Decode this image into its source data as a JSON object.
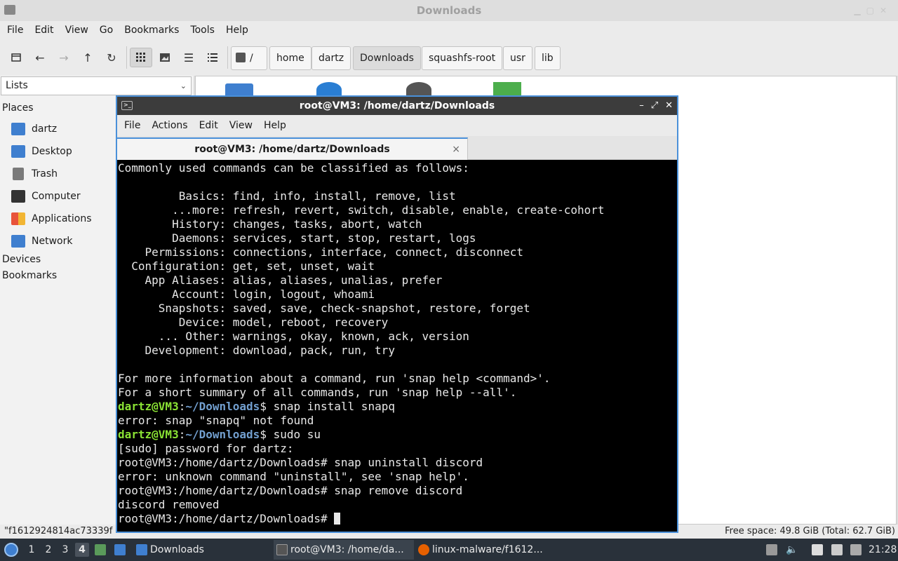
{
  "file_manager": {
    "title": "Downloads",
    "menu": [
      "File",
      "Edit",
      "View",
      "Go",
      "Bookmarks",
      "Tools",
      "Help"
    ],
    "breadcrumb_root": "/",
    "breadcrumbs": [
      "home",
      "dartz",
      "Downloads",
      "squashfs-root",
      "usr",
      "lib"
    ],
    "side_select": "Lists",
    "places_heading": "Places",
    "places": [
      {
        "label": "dartz",
        "icon": "home-folder-icon",
        "color": "#3f7fcf"
      },
      {
        "label": "Desktop",
        "icon": "desktop-icon",
        "color": "#3f7fcf"
      },
      {
        "label": "Trash",
        "icon": "trash-icon",
        "color": "#6e6e6e"
      },
      {
        "label": "Computer",
        "icon": "computer-icon",
        "color": "#333333"
      },
      {
        "label": "Applications",
        "icon": "applications-icon",
        "color": "#e8533a"
      },
      {
        "label": "Network",
        "icon": "network-icon",
        "color": "#3f7fcf"
      }
    ],
    "devices_heading": "Devices",
    "bookmarks_heading": "Bookmarks",
    "status_left": "\"f1612924814ac73339f",
    "status_right": "Free space: 49.8 GiB (Total: 62.7 GiB)"
  },
  "terminal": {
    "title": "root@VM3: /home/dartz/Downloads",
    "menu": [
      "File",
      "Actions",
      "Edit",
      "View",
      "Help"
    ],
    "tab_label": "root@VM3: /home/dartz/Downloads",
    "tab_close": "×",
    "lines": [
      {
        "type": "out",
        "text": "Commonly used commands can be classified as follows:"
      },
      {
        "type": "out",
        "text": ""
      },
      {
        "type": "out",
        "text": "         Basics: find, info, install, remove, list"
      },
      {
        "type": "out",
        "text": "        ...more: refresh, revert, switch, disable, enable, create-cohort"
      },
      {
        "type": "out",
        "text": "        History: changes, tasks, abort, watch"
      },
      {
        "type": "out",
        "text": "        Daemons: services, start, stop, restart, logs"
      },
      {
        "type": "out",
        "text": "    Permissions: connections, interface, connect, disconnect"
      },
      {
        "type": "out",
        "text": "  Configuration: get, set, unset, wait"
      },
      {
        "type": "out",
        "text": "    App Aliases: alias, aliases, unalias, prefer"
      },
      {
        "type": "out",
        "text": "        Account: login, logout, whoami"
      },
      {
        "type": "out",
        "text": "      Snapshots: saved, save, check-snapshot, restore, forget"
      },
      {
        "type": "out",
        "text": "         Device: model, reboot, recovery"
      },
      {
        "type": "out",
        "text": "      ... Other: warnings, okay, known, ack, version"
      },
      {
        "type": "out",
        "text": "    Development: download, pack, run, try"
      },
      {
        "type": "out",
        "text": ""
      },
      {
        "type": "out",
        "text": "For more information about a command, run 'snap help <command>'."
      },
      {
        "type": "out",
        "text": "For a short summary of all commands, run 'snap help --all'."
      },
      {
        "type": "prompt",
        "user": "dartz@VM3",
        "path": "~/Downloads",
        "cmd": "$ snap install snapq"
      },
      {
        "type": "out",
        "text": "error: snap \"snapq\" not found"
      },
      {
        "type": "prompt",
        "user": "dartz@VM3",
        "path": "~/Downloads",
        "cmd": "$ sudo su"
      },
      {
        "type": "out",
        "text": "[sudo] password for dartz:"
      },
      {
        "type": "out",
        "text": "root@VM3:/home/dartz/Downloads# snap uninstall discord"
      },
      {
        "type": "out",
        "text": "error: unknown command \"uninstall\", see 'snap help'."
      },
      {
        "type": "out",
        "text": "root@VM3:/home/dartz/Downloads# snap remove discord"
      },
      {
        "type": "out",
        "text": "discord removed"
      },
      {
        "type": "cursor",
        "text": "root@VM3:/home/dartz/Downloads# "
      }
    ]
  },
  "taskbar": {
    "desktops": [
      "1",
      "2",
      "3",
      "4"
    ],
    "active_desktop": "4",
    "tasks": [
      {
        "label": "Downloads",
        "icon": "folder-icon",
        "color": "#3f7fcf"
      },
      {
        "label": "root@VM3: /home/da...",
        "icon": "terminal-icon",
        "color": "#555555"
      },
      {
        "label": "linux-malware/f1612...",
        "icon": "firefox-icon",
        "color": "#e66000"
      }
    ],
    "clock": "21:28"
  }
}
